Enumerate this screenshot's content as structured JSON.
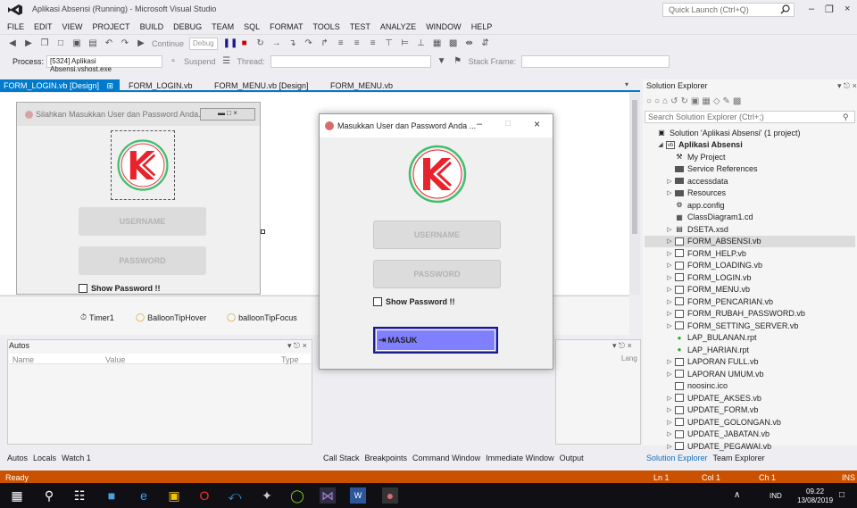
{
  "window": {
    "title": "Aplikasi Absensi (Running) - Microsoft Visual Studio",
    "quick_launch_placeholder": "Quick Launch (Ctrl+Q)"
  },
  "menu": [
    "FILE",
    "EDIT",
    "VIEW",
    "PROJECT",
    "BUILD",
    "DEBUG",
    "TEAM",
    "SQL",
    "FORMAT",
    "TOOLS",
    "TEST",
    "ANALYZE",
    "WINDOW",
    "HELP"
  ],
  "toolbar": {
    "continue_label": "Continue",
    "debug_config": "Debug",
    "process_label": "Process:",
    "process_value": "[5324] Aplikasi Absensi.vshost.exe",
    "suspend_label": "Suspend",
    "thread_label": "Thread:",
    "stack_frame_label": "Stack Frame:"
  },
  "doc_tabs": {
    "active": "FORM_LOGIN.vb [Design]",
    "tab2": "FORM_LOGIN.vb",
    "tab3": "FORM_MENU.vb [Design]",
    "tab4": "FORM_MENU.vb"
  },
  "designer": {
    "form_title": "Silahkan Masukkan User dan Password Anda...",
    "username_placeholder": "USERNAME",
    "password_placeholder": "PASSWORD",
    "show_password": "Show Password !!",
    "tray": [
      "Timer1",
      "BalloonTipHover",
      "balloonTipFocus"
    ]
  },
  "autos": {
    "title": "Autos",
    "columns": [
      "Name",
      "Value",
      "Type"
    ],
    "right_col": "Lang"
  },
  "bottom_tabs_left": [
    "Autos",
    "Locals",
    "Watch 1"
  ],
  "bottom_tabs_mid": [
    "Call Stack",
    "Breakpoints",
    "Command Window",
    "Immediate Window",
    "Output"
  ],
  "dialog": {
    "title": "Masukkan User dan Password Anda ...",
    "username_placeholder": "USERNAME",
    "password_placeholder": "PASSWORD",
    "show_password": "Show Password !!",
    "submit_label": "MASUK"
  },
  "solution_explorer": {
    "title": "Solution Explorer",
    "search_placeholder": "Search Solution Explorer (Ctrl+;)",
    "items": [
      {
        "label": "Solution 'Aplikasi Absensi' (1 project)",
        "indent": 0,
        "arrow": "",
        "icon": "solution",
        "bold": false
      },
      {
        "label": "Aplikasi Absensi",
        "indent": 1,
        "arrow": "◢",
        "icon": "vb",
        "bold": true
      },
      {
        "label": "My Project",
        "indent": 2,
        "arrow": "",
        "icon": "wrench",
        "bold": false
      },
      {
        "label": "Service References",
        "indent": 2,
        "arrow": "",
        "icon": "folder",
        "bold": false
      },
      {
        "label": "accessdata",
        "indent": 2,
        "arrow": "▷",
        "icon": "folder",
        "bold": false
      },
      {
        "label": "Resources",
        "indent": 2,
        "arrow": "▷",
        "icon": "folder",
        "bold": false
      },
      {
        "label": "app.config",
        "indent": 2,
        "arrow": "",
        "icon": "config",
        "bold": false
      },
      {
        "label": "ClassDiagram1.cd",
        "indent": 2,
        "arrow": "",
        "icon": "diagram",
        "bold": false
      },
      {
        "label": "DSETA.xsd",
        "indent": 2,
        "arrow": "▷",
        "icon": "dataset",
        "bold": false
      },
      {
        "label": "FORM_ABSENSI.vb",
        "indent": 2,
        "arrow": "▷",
        "icon": "form",
        "bold": false,
        "selected": true
      },
      {
        "label": "FORM_HELP.vb",
        "indent": 2,
        "arrow": "▷",
        "icon": "form",
        "bold": false
      },
      {
        "label": "FORM_LOADING.vb",
        "indent": 2,
        "arrow": "▷",
        "icon": "form",
        "bold": false
      },
      {
        "label": "FORM_LOGIN.vb",
        "indent": 2,
        "arrow": "▷",
        "icon": "form",
        "bold": false
      },
      {
        "label": "FORM_MENU.vb",
        "indent": 2,
        "arrow": "▷",
        "icon": "form",
        "bold": false
      },
      {
        "label": "FORM_PENCARIAN.vb",
        "indent": 2,
        "arrow": "▷",
        "icon": "form",
        "bold": false
      },
      {
        "label": "FORM_RUBAH_PASSWORD.vb",
        "indent": 2,
        "arrow": "▷",
        "icon": "form",
        "bold": false
      },
      {
        "label": "FORM_SETTING_SERVER.vb",
        "indent": 2,
        "arrow": "▷",
        "icon": "form",
        "bold": false
      },
      {
        "label": "LAP_BULANAN.rpt",
        "indent": 2,
        "arrow": "",
        "icon": "report",
        "bold": false
      },
      {
        "label": "LAP_HARIAN.rpt",
        "indent": 2,
        "arrow": "",
        "icon": "report",
        "bold": false
      },
      {
        "label": "LAPORAN FULL.vb",
        "indent": 2,
        "arrow": "▷",
        "icon": "form",
        "bold": false
      },
      {
        "label": "LAPORAN UMUM.vb",
        "indent": 2,
        "arrow": "▷",
        "icon": "form",
        "bold": false
      },
      {
        "label": "noosinc.ico",
        "indent": 2,
        "arrow": "",
        "icon": "image",
        "bold": false
      },
      {
        "label": "UPDATE_AKSES.vb",
        "indent": 2,
        "arrow": "▷",
        "icon": "form",
        "bold": false
      },
      {
        "label": "UPDATE_FORM.vb",
        "indent": 2,
        "arrow": "▷",
        "icon": "form",
        "bold": false
      },
      {
        "label": "UPDATE_GOLONGAN.vb",
        "indent": 2,
        "arrow": "▷",
        "icon": "form",
        "bold": false
      },
      {
        "label": "UPDATE_JABATAN.vb",
        "indent": 2,
        "arrow": "▷",
        "icon": "form",
        "bold": false
      },
      {
        "label": "UPDATE_PEGAWAI.vb",
        "indent": 2,
        "arrow": "▷",
        "icon": "form",
        "bold": false
      }
    ],
    "tabs": [
      "Solution Explorer",
      "Team Explorer"
    ]
  },
  "status": {
    "state": "Ready",
    "line": "Ln 1",
    "col": "Col 1",
    "ch": "Ch 1",
    "mode": "INS"
  },
  "taskbar": {
    "lang": "IND",
    "time": "09.22",
    "date": "13/08/2019"
  },
  "colors": {
    "accent": "#007acc",
    "status_bar": "#ca5100",
    "logo_red": "#e8232b",
    "logo_ring": "#3fbf6b",
    "button_fill": "#8080ff"
  }
}
